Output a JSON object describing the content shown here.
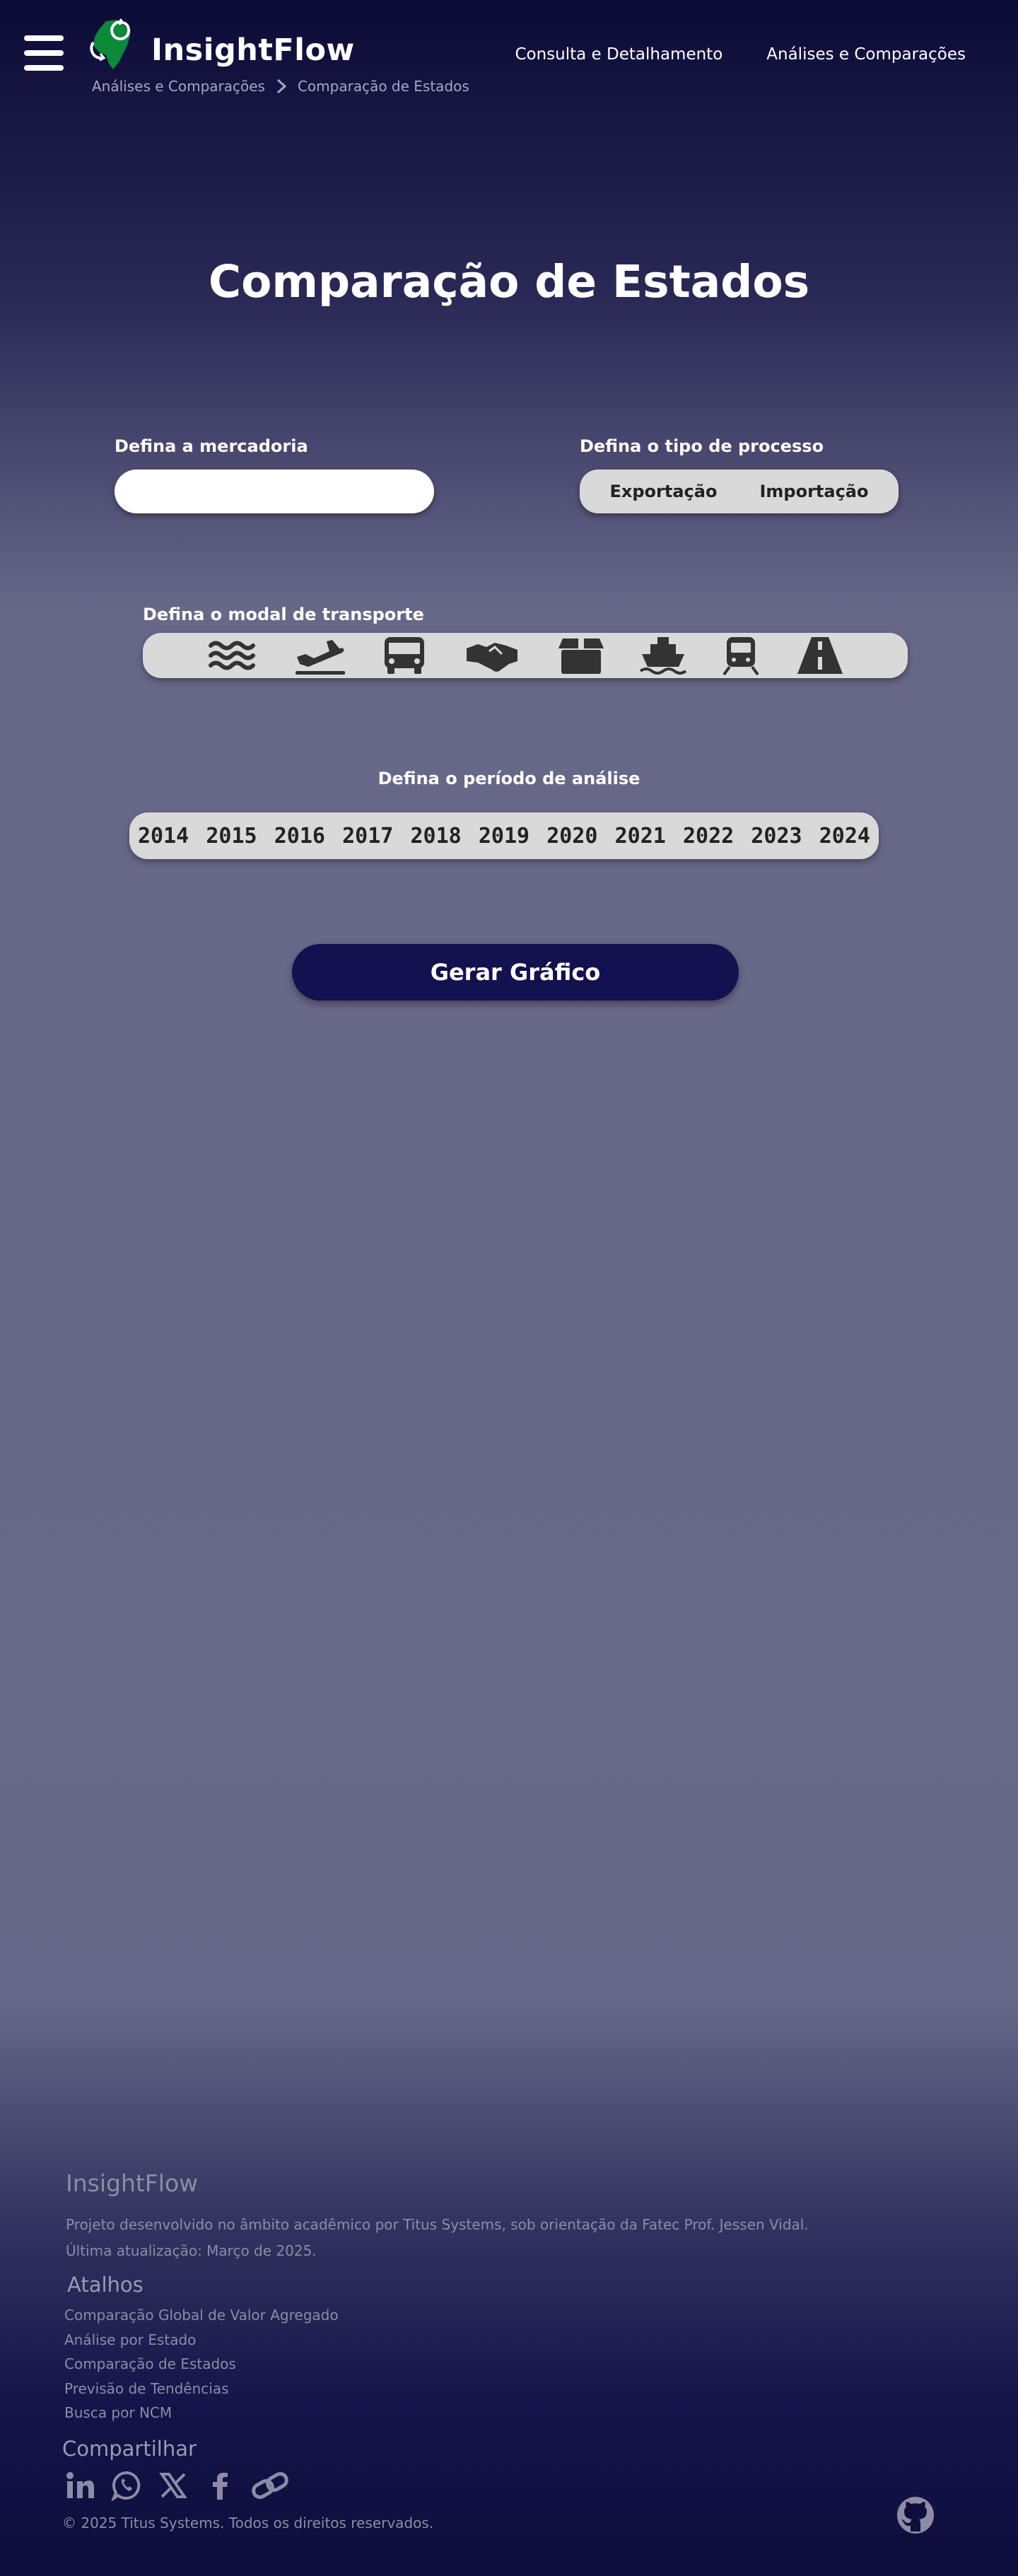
{
  "header": {
    "brand": "InsightFlow",
    "breadcrumb": [
      "Análises e Comparações",
      "Comparação de Estados"
    ],
    "nav": [
      "Consulta e Detalhamento",
      "Análises e Comparações"
    ]
  },
  "page_title": "Comparação de Estados",
  "form": {
    "mercadoria_label": "Defina a mercadoria",
    "mercadoria_value": "",
    "processo_label": "Defina o tipo de processo",
    "processo_options": [
      "Exportação",
      "Importação"
    ],
    "modal_label": "Defina o modal de transporte",
    "modal_icons": [
      "waves-icon",
      "airplane-icon",
      "bus-icon",
      "handshake-icon",
      "box-icon",
      "ship-icon",
      "train-icon",
      "road-icon"
    ],
    "periodo_label": "Defina o período de análise",
    "years": [
      "2014",
      "2015",
      "2016",
      "2017",
      "2018",
      "2019",
      "2020",
      "2021",
      "2022",
      "2023",
      "2024"
    ],
    "submit_label": "Gerar Gráfico"
  },
  "footer": {
    "brand": "InsightFlow",
    "description": "Projeto desenvolvido no âmbito acadêmico por Titus Systems, sob orientação da Fatec Prof. Jessen Vidal.",
    "updated": "Última atualização: Março de 2025.",
    "shortcuts_heading": "Atalhos",
    "shortcuts": [
      "Comparação Global de Valor Agregado",
      "Análise por Estado",
      "Comparação de Estados",
      "Previsão de Tendências",
      "Busca por NCM"
    ],
    "share_heading": "Compartilhar",
    "share_icons": [
      "linkedin-icon",
      "whatsapp-icon",
      "x-icon",
      "facebook-icon",
      "link-icon"
    ],
    "copyright": "© 2025 Titus Systems. Todos os direitos reservados.",
    "github_icon": "github-icon"
  },
  "colors": {
    "brand_green": "#0c8a3a",
    "button_navy": "#131150",
    "pill_gray": "#d9d9d9",
    "icon_dark": "#333333"
  }
}
